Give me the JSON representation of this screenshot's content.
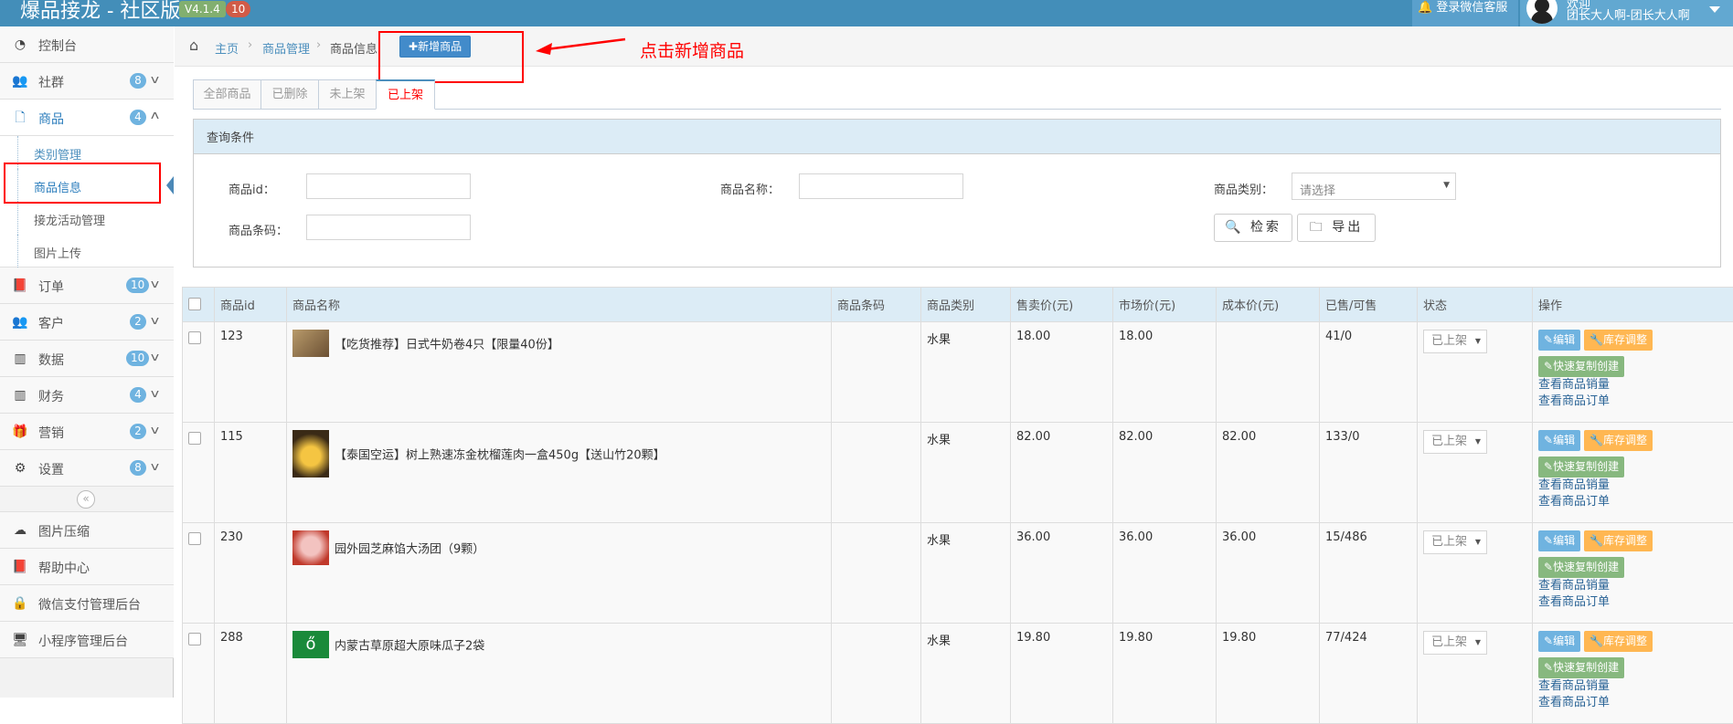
{
  "header": {
    "brand": "爆品接龙 - 社区版",
    "version": "V4.1.4",
    "version_count": "10",
    "wx_service": "登录微信客服",
    "welcome": "欢迎",
    "user": "团长大人啊-团长大人啊"
  },
  "sidebar": {
    "items": [
      {
        "label": "控制台",
        "icon": "dashboard-icon",
        "badge": ""
      },
      {
        "label": "社群",
        "icon": "users-icon",
        "badge": "8"
      },
      {
        "label": "商品",
        "icon": "file-icon",
        "badge": "4"
      },
      {
        "label": "订单",
        "icon": "book-icon",
        "badge": "10"
      },
      {
        "label": "客户",
        "icon": "users-icon",
        "badge": "2"
      },
      {
        "label": "数据",
        "icon": "bar-chart-icon",
        "badge": "10"
      },
      {
        "label": "财务",
        "icon": "bar-chart-icon",
        "badge": "4"
      },
      {
        "label": "营销",
        "icon": "gift-icon",
        "badge": "2"
      },
      {
        "label": "设置",
        "icon": "gears-icon",
        "badge": "8"
      }
    ],
    "subitems": [
      "类别管理",
      "商品信息",
      "接龙活动管理",
      "图片上传"
    ],
    "bottom": [
      {
        "label": "图片压缩",
        "icon": "cloud-upload-icon"
      },
      {
        "label": "帮助中心",
        "icon": "book-icon"
      },
      {
        "label": "微信支付管理后台",
        "icon": "lock-icon"
      },
      {
        "label": "小程序管理后台",
        "icon": "desktop-icon"
      }
    ],
    "collapse": "«"
  },
  "breadcrumb": {
    "home": "主页",
    "mid": "商品管理",
    "current": "商品信息"
  },
  "add_button": "新增商品",
  "annotation": "点击新增商品",
  "tabs": [
    "全部商品",
    "已删除",
    "未上架",
    "已上架"
  ],
  "query": {
    "title": "查询条件",
    "id_label": "商品id：",
    "name_label": "商品名称：",
    "category_label": "商品类别：",
    "category_placeholder": "请选择",
    "barcode_label": "商品条码：",
    "search": "检索",
    "export": "导出"
  },
  "table": {
    "headers": [
      "商品id",
      "商品名称",
      "商品条码",
      "商品类别",
      "售卖价(元)",
      "市场价(元)",
      "成本价(元)",
      "已售/可售",
      "状态",
      "操作"
    ],
    "rows": [
      {
        "id": "123",
        "name": "【吃货推荐】日式牛奶卷4只【限量40份】",
        "barcode": "",
        "category": "水果",
        "sell": "18.00",
        "market": "18.00",
        "cost": "",
        "sold": "41/0",
        "status": "已上架"
      },
      {
        "id": "115",
        "name": "【泰国空运】树上熟速冻金枕榴莲肉一盒450g【送山竹20颗】",
        "barcode": "",
        "category": "水果",
        "sell": "82.00",
        "market": "82.00",
        "cost": "82.00",
        "sold": "133/0",
        "status": "已上架"
      },
      {
        "id": "230",
        "name": "园外园芝麻馅大汤团（9颗）",
        "barcode": "",
        "category": "水果",
        "sell": "36.00",
        "market": "36.00",
        "cost": "36.00",
        "sold": "15/486",
        "status": "已上架"
      },
      {
        "id": "288",
        "name": "内蒙古草原超大原味瓜子2袋",
        "barcode": "",
        "category": "水果",
        "sell": "19.80",
        "market": "19.80",
        "cost": "19.80",
        "sold": "77/424",
        "status": "已上架"
      }
    ],
    "ops": {
      "edit": "编辑",
      "stock": "库存调整",
      "copy": "快速复制创建",
      "sales": "查看商品销量",
      "orders": "查看商品订单"
    }
  },
  "colors": {
    "topbar": "#438eb9",
    "accent": "#428bca",
    "annotation_red": "#ff0000"
  }
}
